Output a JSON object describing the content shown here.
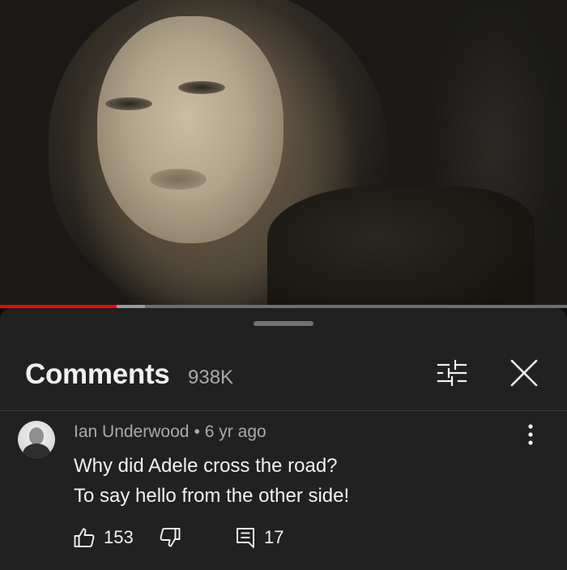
{
  "video": {
    "progress_played": 0.205,
    "progress_buffered": 0.255,
    "colors": {
      "played": "#ff0000",
      "buffered": "#9a9a9a",
      "track": "#6e6e6e"
    }
  },
  "comments_panel": {
    "title": "Comments",
    "count": "938K",
    "filter_icon": "sort-filter-icon",
    "close_icon": "close-icon"
  },
  "comment": {
    "author": "Ian Underwood",
    "separator": "•",
    "time": "6 yr ago",
    "lines": [
      "Why did Adele cross the road?",
      "To say hello from the other side!"
    ],
    "likes": "153",
    "replies": "17",
    "icons": {
      "like": "thumbs-up-icon",
      "dislike": "thumbs-down-icon",
      "reply": "reply-icon",
      "more": "more-vertical-icon"
    }
  }
}
